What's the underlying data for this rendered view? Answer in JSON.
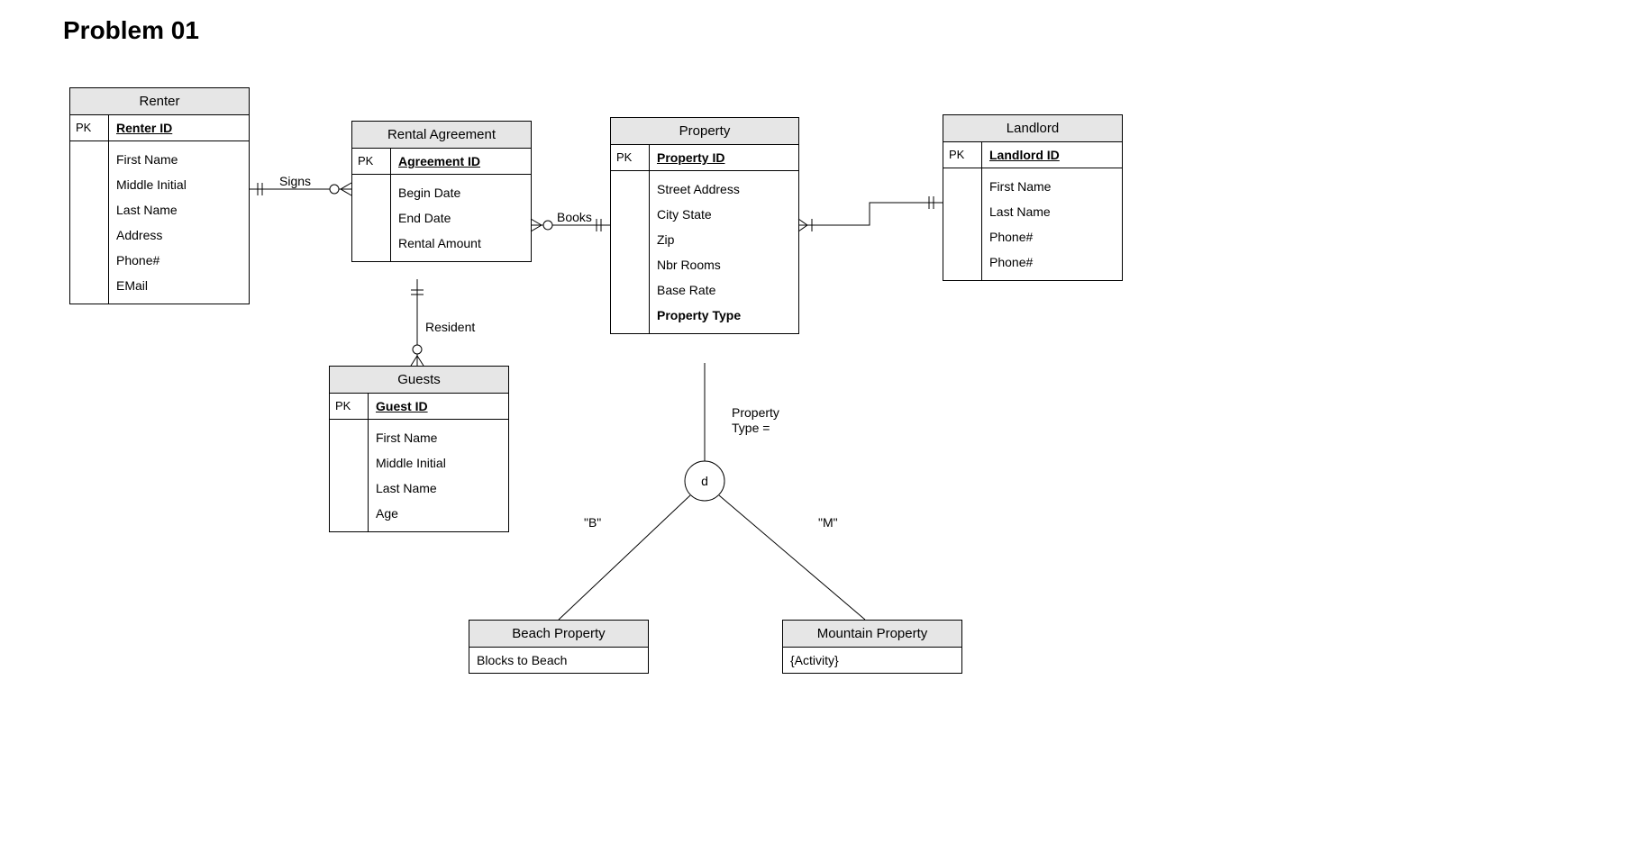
{
  "title": "Problem 01",
  "entities": {
    "renter": {
      "name": "Renter",
      "pk_label": "PK",
      "pk_name": "Renter ID",
      "attrs": [
        "First Name",
        "Middle Initial",
        "Last Name",
        "Address",
        "Phone#",
        "EMail"
      ]
    },
    "agreement": {
      "name": "Rental Agreement",
      "pk_label": "PK",
      "pk_name": "Agreement ID",
      "attrs": [
        "Begin Date",
        "End Date",
        "Rental Amount"
      ]
    },
    "property": {
      "name": "Property",
      "pk_label": "PK",
      "pk_name": "Property ID",
      "attrs": [
        "Street Address",
        "City State",
        "Zip",
        "Nbr Rooms",
        "Base Rate"
      ],
      "bold_attr": "Property Type"
    },
    "landlord": {
      "name": "Landlord",
      "pk_label": "PK",
      "pk_name": "Landlord ID",
      "attrs": [
        "First Name",
        "Last Name",
        "Phone#",
        "Phone#"
      ]
    },
    "guests": {
      "name": "Guests",
      "pk_label": "PK",
      "pk_name": "Guest ID",
      "attrs": [
        "First Name",
        "Middle Initial",
        "Last Name",
        "Age"
      ]
    }
  },
  "subtypes": {
    "beach": {
      "name": "Beach Property",
      "attr": "Blocks to Beach"
    },
    "mountain": {
      "name": "Mountain Property",
      "attr": "{Activity}"
    }
  },
  "relationships": {
    "signs": "Signs",
    "books": "Books",
    "resident": "Resident",
    "discriminator_label": "Property\nType =",
    "d_symbol": "d",
    "b_label": "\"B\"",
    "m_label": "\"M\""
  }
}
